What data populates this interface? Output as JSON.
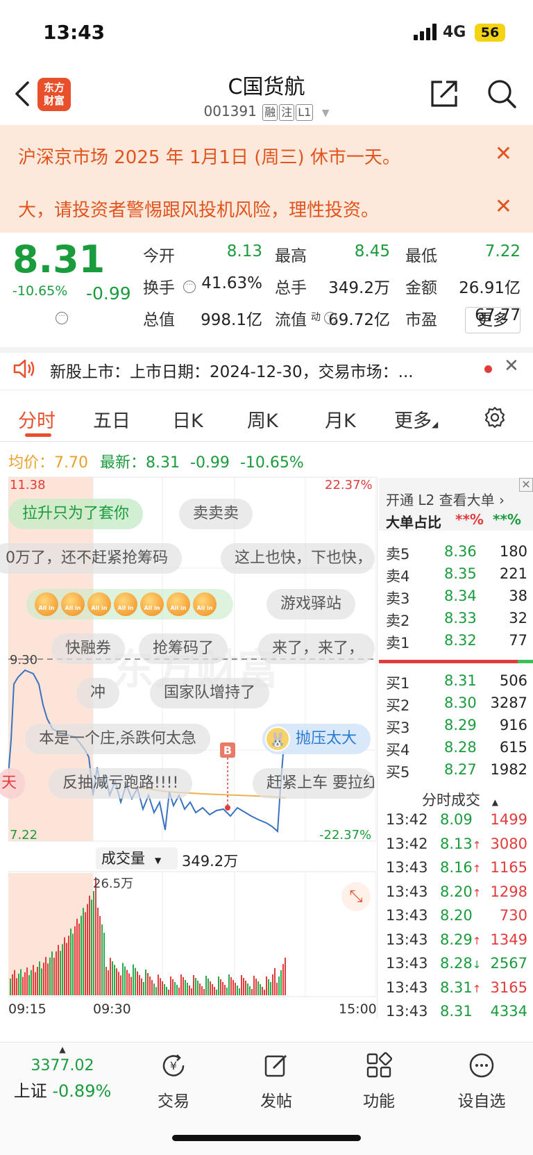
{
  "status": {
    "time": "13:43",
    "network": "4G",
    "battery": "56"
  },
  "header": {
    "logo_line1": "东方",
    "logo_line2": "财富",
    "title": "C国货航",
    "code": "001391",
    "tags": [
      "融",
      "注",
      "L1"
    ]
  },
  "notice": {
    "line1": "沪深京市场 2025 年 1月1日 (周三) 休市一天。",
    "line2": "大，请投资者警惕跟风投机风险，理性投资。"
  },
  "quote": {
    "price": "8.31",
    "pct": "-10.65%",
    "change": "-0.99",
    "fields": [
      {
        "label": "今开",
        "value": "8.13",
        "color": "green"
      },
      {
        "label": "最高",
        "value": "8.45",
        "color": "green"
      },
      {
        "label": "最低",
        "value": "7.22",
        "color": "green"
      },
      {
        "label": "换手",
        "value": "41.63%",
        "color": "dark"
      },
      {
        "label": "总手",
        "value": "349.2万",
        "color": "dark"
      },
      {
        "label": "金额",
        "value": "26.91亿",
        "color": "dark"
      },
      {
        "label": "总值",
        "value": "998.1亿",
        "color": "dark"
      },
      {
        "label": "流值",
        "value": "69.72亿",
        "color": "dark"
      },
      {
        "label": "市盈",
        "value": "67.77",
        "color": "dark"
      }
    ],
    "pe_sup": "动",
    "more": "更多"
  },
  "news": {
    "text": "新股上市：上市日期：2024-12-30，交易市场：..."
  },
  "tabs": [
    "分时",
    "五日",
    "日K",
    "周K",
    "月K",
    "更多"
  ],
  "intraday": {
    "avg_label": "均价：",
    "avg_value": "7.70",
    "latest_label": "最新：",
    "latest_value": "8.31",
    "latest_change": "-0.99",
    "latest_pct": "-10.65%",
    "y_high": "11.38",
    "y_low": "7.22",
    "pct_high": "22.37%",
    "pct_low": "-22.37%",
    "prev_close": "9.30",
    "marker": "B",
    "time_start": "09:15",
    "time_mid": "09:30",
    "time_end": "15:00"
  },
  "barrage": [
    "拉升只为了套你",
    "卖卖卖",
    "0万了，还不赶紧抢筹码",
    "这上也快，下也快，",
    "游戏驿站",
    "快融券",
    "抢筹码了",
    "来了，来了，",
    "冲",
    "国家队增持了",
    "本是一个庄,杀跌何太急",
    "抛压太大",
    "天",
    "反抽减亏跑路!!!!",
    "赶紧上车 要拉红"
  ],
  "allin_label": "All in",
  "volume": {
    "label": "成交量",
    "total": "349.2万",
    "peak": "26.5万"
  },
  "orderbook": {
    "l2_prompt": "开通 L2 查看大单",
    "big_label": "大单占比",
    "big_sell": "**%",
    "big_buy": "**%",
    "asks": [
      {
        "label": "卖5",
        "price": "8.36",
        "vol": "180"
      },
      {
        "label": "卖4",
        "price": "8.35",
        "vol": "221"
      },
      {
        "label": "卖3",
        "price": "8.34",
        "vol": "38"
      },
      {
        "label": "卖2",
        "price": "8.33",
        "vol": "32"
      },
      {
        "label": "卖1",
        "price": "8.32",
        "vol": "77"
      }
    ],
    "bids": [
      {
        "label": "买1",
        "price": "8.31",
        "vol": "506"
      },
      {
        "label": "买2",
        "price": "8.30",
        "vol": "3287"
      },
      {
        "label": "买3",
        "price": "8.29",
        "vol": "916"
      },
      {
        "label": "买4",
        "price": "8.28",
        "vol": "615"
      },
      {
        "label": "买5",
        "price": "8.27",
        "vol": "1982"
      }
    ],
    "trades_label": "分时成交",
    "trades": [
      {
        "time": "13:42",
        "price": "8.09",
        "arrow": "",
        "vol": "1499",
        "vcolor": "red"
      },
      {
        "time": "13:42",
        "price": "8.13",
        "arrow": "↑",
        "vol": "3080",
        "vcolor": "red"
      },
      {
        "time": "13:43",
        "price": "8.16",
        "arrow": "↑",
        "vol": "1165",
        "vcolor": "red"
      },
      {
        "time": "13:43",
        "price": "8.20",
        "arrow": "↑",
        "vol": "1298",
        "vcolor": "red"
      },
      {
        "time": "13:43",
        "price": "8.20",
        "arrow": "",
        "vol": "730",
        "vcolor": "red"
      },
      {
        "time": "13:43",
        "price": "8.29",
        "arrow": "↑",
        "vol": "1349",
        "vcolor": "red"
      },
      {
        "time": "13:43",
        "price": "8.28",
        "arrow": "↓",
        "vol": "2567",
        "vcolor": "green"
      },
      {
        "time": "13:43",
        "price": "8.31",
        "arrow": "↑",
        "vol": "3165",
        "vcolor": "red"
      },
      {
        "time": "13:43",
        "price": "8.31",
        "arrow": "",
        "vol": "4334",
        "vcolor": "green"
      }
    ]
  },
  "bottom": {
    "index_value": "3377.02",
    "index_name": "上证",
    "index_pct": "-0.89%",
    "nav": [
      "交易",
      "发帖",
      "功能",
      "设自选"
    ]
  }
}
